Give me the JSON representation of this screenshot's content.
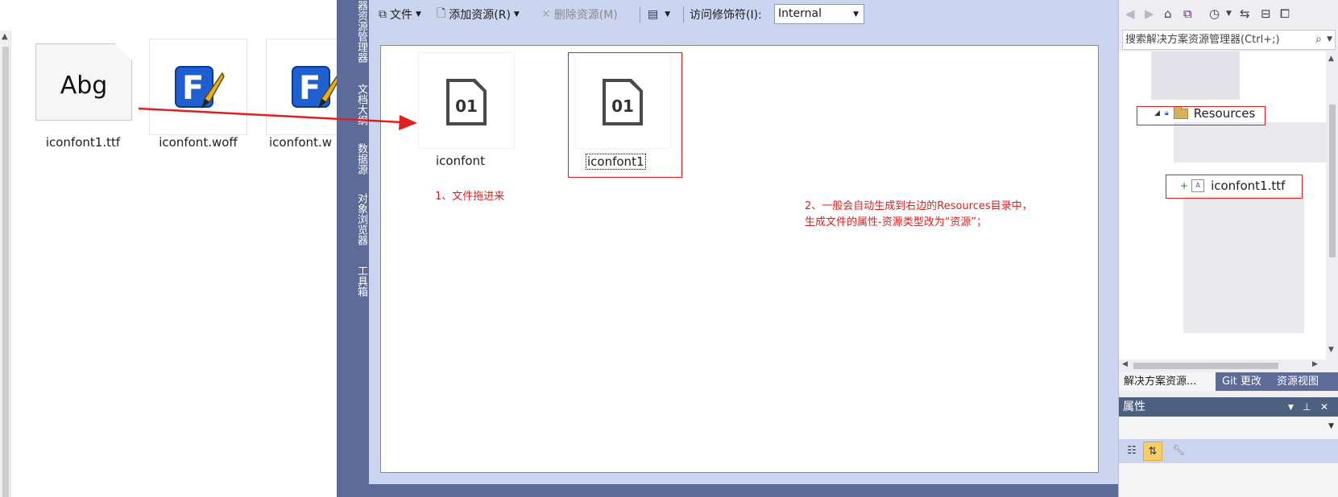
{
  "explorer": {
    "files": [
      {
        "name": "iconfont1.ttf",
        "preview_text": "Abg",
        "icon": "font-file-icon"
      },
      {
        "name": "iconfont.woff",
        "icon": "fontcreator-icon"
      },
      {
        "name": "iconfont.w",
        "icon": "fontcreator-icon"
      }
    ],
    "logo_letter": "F"
  },
  "toolstrip": {
    "tabs": [
      "器资源管理器",
      "文档大纲",
      "数据源",
      "对象浏览器",
      "工具箱"
    ]
  },
  "designer": {
    "toolbar": {
      "file_label": "文件",
      "add_resource_label": "添加资源(R)",
      "remove_resource_label": "删除资源(M)",
      "access_label": "访问修饰符(I):",
      "access_value": "Internal"
    },
    "resources": [
      {
        "name": "iconfont",
        "icon_text": "01"
      },
      {
        "name": "iconfont1",
        "icon_text": "01"
      }
    ],
    "notes": {
      "step1": "1、文件拖进来",
      "step2_line1": "2、一般会自动生成到右边的Resources目录中，",
      "step2_line2": "生成文件的属性-资源类型改为“资源”；"
    }
  },
  "solution_explorer": {
    "search_placeholder": "搜索解决方案资源管理器(Ctrl+;)",
    "folder_name": "Resources",
    "file_name": "iconfont1.ttf",
    "file_icon_text": "A",
    "tabs": [
      "解决方案资源...",
      "Git 更改",
      "资源视图"
    ]
  },
  "properties": {
    "title": "属性"
  },
  "colors": {
    "accent_red": "#e02020",
    "vs_blue": "#5d6b99",
    "toolbar_bg": "#ccd5f0"
  }
}
